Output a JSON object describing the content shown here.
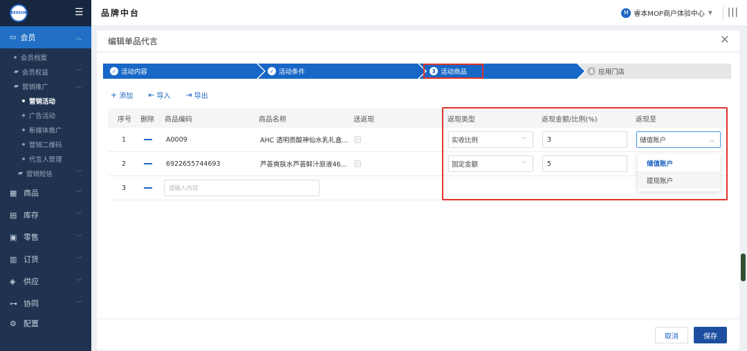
{
  "sidebar": {
    "logo_text": "REASUN",
    "member_label": "会员",
    "items_member": [
      {
        "label": "会员档案"
      },
      {
        "label": "会员权益"
      },
      {
        "label": "营销推广"
      },
      {
        "label": "营销活动"
      },
      {
        "label": "广告活动"
      },
      {
        "label": "新媒体推广"
      },
      {
        "label": "营销二维码"
      },
      {
        "label": "代言人管理"
      },
      {
        "label": "营销短信"
      }
    ],
    "main": [
      {
        "label": "商品"
      },
      {
        "label": "库存"
      },
      {
        "label": "零售"
      },
      {
        "label": "订货"
      },
      {
        "label": "供应"
      },
      {
        "label": "协同"
      },
      {
        "label": "配置"
      }
    ]
  },
  "topbar": {
    "brand": "品牌中台",
    "user_initial": "M",
    "user_name": "睿本MOP商户体验中心"
  },
  "dialog": {
    "title": "编辑单品代言",
    "steps": [
      {
        "label": "活动内容",
        "icon": "✓"
      },
      {
        "label": "活动条件",
        "icon": "✓"
      },
      {
        "label": "活动商品",
        "icon": "3"
      },
      {
        "label": "应用门店",
        "icon": "4"
      }
    ],
    "toolbar": {
      "add": "添加",
      "import": "导入",
      "export": "导出"
    },
    "columns": {
      "seq": "序号",
      "delete": "删除",
      "code": "商品编码",
      "name": "商品名称",
      "cashback_send": "送返现",
      "cashback_type": "返现类型",
      "amount": "返现金额/比例(%)",
      "to": "返现至"
    },
    "rows": [
      {
        "seq": "1",
        "code": "A0009",
        "name": "AHC 透明质酸神仙水乳礼盒...",
        "type": "实收比例",
        "amount": "3",
        "to": "储值账户"
      },
      {
        "seq": "2",
        "code": "6922655744693",
        "name": "芦荟爽肤水芦荟鲜汁原液46...",
        "type": "固定金额",
        "amount": "5",
        "to": ""
      },
      {
        "seq": "3",
        "code_placeholder": "请输入内容"
      }
    ],
    "dropdown_options": [
      {
        "label": "储值账户"
      },
      {
        "label": "提现账户"
      }
    ],
    "buttons": {
      "cancel": "取消",
      "save": "保存"
    }
  }
}
